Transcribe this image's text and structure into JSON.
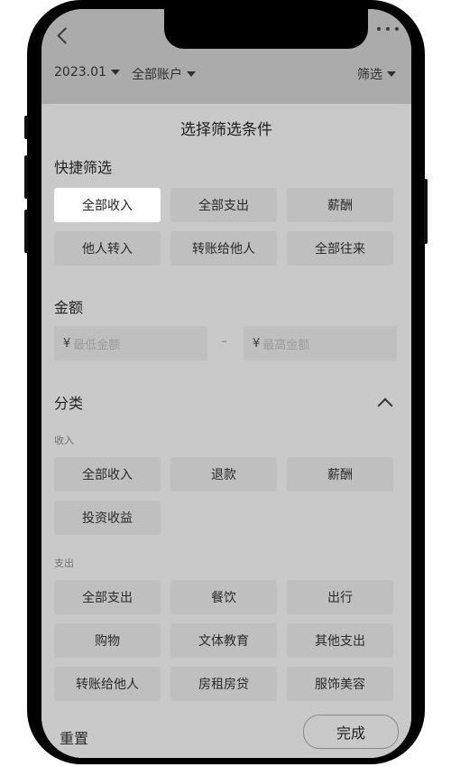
{
  "header": {
    "month": "2023.01",
    "account": "全部账户",
    "filter": "筛选"
  },
  "sheet": {
    "title": "选择筛选条件",
    "quick": {
      "title": "快捷筛选",
      "chips": [
        "全部收入",
        "全部支出",
        "薪酬",
        "他人转入",
        "转账给他人",
        "全部往来"
      ],
      "selected": "全部收入"
    },
    "amount": {
      "title": "金额",
      "currency": "¥",
      "min_placeholder": "最低金额",
      "max_placeholder": "最高金额",
      "separator": "–"
    },
    "category": {
      "title": "分类",
      "income": {
        "title": "收入",
        "chips": [
          "全部收入",
          "退款",
          "薪酬",
          "投资收益"
        ]
      },
      "expense": {
        "title": "支出",
        "chips": [
          "全部支出",
          "餐饮",
          "出行",
          "购物",
          "文体教育",
          "其他支出",
          "转账给他人",
          "房租房贷",
          "服饰美容"
        ]
      }
    },
    "footer": {
      "reset": "重置",
      "done": "完成"
    }
  }
}
